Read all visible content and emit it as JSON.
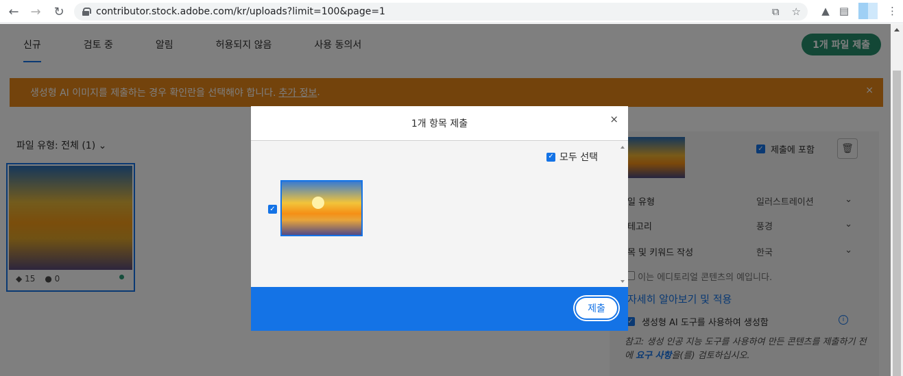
{
  "browser": {
    "url": "contributor.stock.adobe.com/kr/uploads?limit=100&page=1"
  },
  "tabs": [
    {
      "label": "신규",
      "active": true
    },
    {
      "label": "검토 중"
    },
    {
      "label": "알림"
    },
    {
      "label": "허용되지 않음"
    },
    {
      "label": "사용 동의서"
    }
  ],
  "top_submit": "1개 파일 제출",
  "banner": {
    "text": "생성형 AI 이미지를 제출하는 경우 확인란을 선택해야 합니다.",
    "link": "추가 정보",
    "suffix": ".",
    "close": "×"
  },
  "filter": "파일 유형: 전체 (1)",
  "thumb": {
    "keywords": "15",
    "people": "0"
  },
  "right_panel": {
    "include_label": "제출에 포함",
    "rows": [
      {
        "label": "파일 유형",
        "value": "일러스트레이션"
      },
      {
        "label": "카테고리",
        "value": "풍경"
      },
      {
        "label": "제목 및 키워드 작성",
        "value": "한국"
      }
    ],
    "editorial": "이는 에디토리얼 콘텐츠의 예입니다.",
    "link": "자세히 알아보기 및 적용",
    "ai_label": "생성형 AI 도구를 사용하여 생성함",
    "note_prefix": "참고: 생성 인공 지능 도구를 사용하여 만든 콘텐츠를 제출하기 전에 ",
    "note_link": "요구 사항",
    "note_suffix": "을(를) 검토하십시오."
  },
  "modal": {
    "title": "1개 항목 제출",
    "close": "×",
    "select_all": "모두 선택",
    "submit": "제출"
  }
}
